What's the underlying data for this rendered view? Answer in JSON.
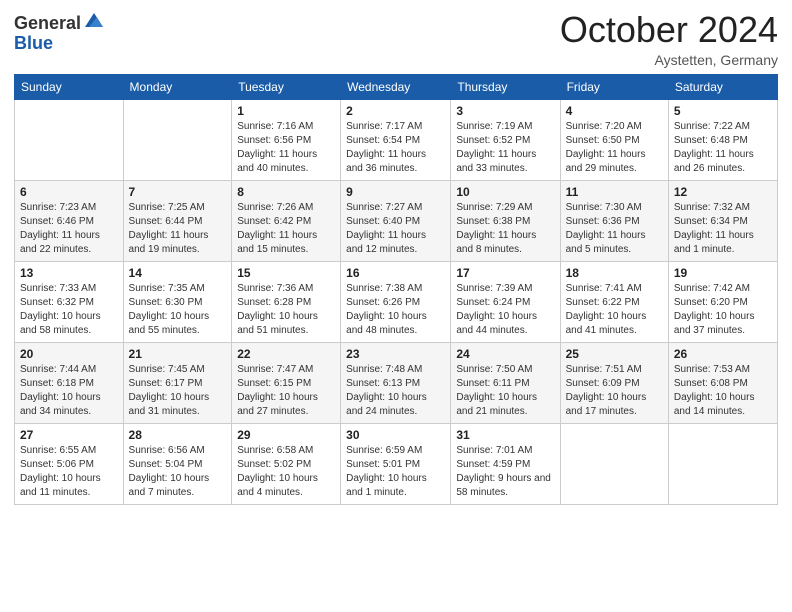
{
  "header": {
    "logo_general": "General",
    "logo_blue": "Blue",
    "month": "October 2024",
    "location": "Aystetten, Germany"
  },
  "weekdays": [
    "Sunday",
    "Monday",
    "Tuesday",
    "Wednesday",
    "Thursday",
    "Friday",
    "Saturday"
  ],
  "weeks": [
    [
      {
        "day": "",
        "info": ""
      },
      {
        "day": "",
        "info": ""
      },
      {
        "day": "1",
        "info": "Sunrise: 7:16 AM\nSunset: 6:56 PM\nDaylight: 11 hours and 40 minutes."
      },
      {
        "day": "2",
        "info": "Sunrise: 7:17 AM\nSunset: 6:54 PM\nDaylight: 11 hours and 36 minutes."
      },
      {
        "day": "3",
        "info": "Sunrise: 7:19 AM\nSunset: 6:52 PM\nDaylight: 11 hours and 33 minutes."
      },
      {
        "day": "4",
        "info": "Sunrise: 7:20 AM\nSunset: 6:50 PM\nDaylight: 11 hours and 29 minutes."
      },
      {
        "day": "5",
        "info": "Sunrise: 7:22 AM\nSunset: 6:48 PM\nDaylight: 11 hours and 26 minutes."
      }
    ],
    [
      {
        "day": "6",
        "info": "Sunrise: 7:23 AM\nSunset: 6:46 PM\nDaylight: 11 hours and 22 minutes."
      },
      {
        "day": "7",
        "info": "Sunrise: 7:25 AM\nSunset: 6:44 PM\nDaylight: 11 hours and 19 minutes."
      },
      {
        "day": "8",
        "info": "Sunrise: 7:26 AM\nSunset: 6:42 PM\nDaylight: 11 hours and 15 minutes."
      },
      {
        "day": "9",
        "info": "Sunrise: 7:27 AM\nSunset: 6:40 PM\nDaylight: 11 hours and 12 minutes."
      },
      {
        "day": "10",
        "info": "Sunrise: 7:29 AM\nSunset: 6:38 PM\nDaylight: 11 hours and 8 minutes."
      },
      {
        "day": "11",
        "info": "Sunrise: 7:30 AM\nSunset: 6:36 PM\nDaylight: 11 hours and 5 minutes."
      },
      {
        "day": "12",
        "info": "Sunrise: 7:32 AM\nSunset: 6:34 PM\nDaylight: 11 hours and 1 minute."
      }
    ],
    [
      {
        "day": "13",
        "info": "Sunrise: 7:33 AM\nSunset: 6:32 PM\nDaylight: 10 hours and 58 minutes."
      },
      {
        "day": "14",
        "info": "Sunrise: 7:35 AM\nSunset: 6:30 PM\nDaylight: 10 hours and 55 minutes."
      },
      {
        "day": "15",
        "info": "Sunrise: 7:36 AM\nSunset: 6:28 PM\nDaylight: 10 hours and 51 minutes."
      },
      {
        "day": "16",
        "info": "Sunrise: 7:38 AM\nSunset: 6:26 PM\nDaylight: 10 hours and 48 minutes."
      },
      {
        "day": "17",
        "info": "Sunrise: 7:39 AM\nSunset: 6:24 PM\nDaylight: 10 hours and 44 minutes."
      },
      {
        "day": "18",
        "info": "Sunrise: 7:41 AM\nSunset: 6:22 PM\nDaylight: 10 hours and 41 minutes."
      },
      {
        "day": "19",
        "info": "Sunrise: 7:42 AM\nSunset: 6:20 PM\nDaylight: 10 hours and 37 minutes."
      }
    ],
    [
      {
        "day": "20",
        "info": "Sunrise: 7:44 AM\nSunset: 6:18 PM\nDaylight: 10 hours and 34 minutes."
      },
      {
        "day": "21",
        "info": "Sunrise: 7:45 AM\nSunset: 6:17 PM\nDaylight: 10 hours and 31 minutes."
      },
      {
        "day": "22",
        "info": "Sunrise: 7:47 AM\nSunset: 6:15 PM\nDaylight: 10 hours and 27 minutes."
      },
      {
        "day": "23",
        "info": "Sunrise: 7:48 AM\nSunset: 6:13 PM\nDaylight: 10 hours and 24 minutes."
      },
      {
        "day": "24",
        "info": "Sunrise: 7:50 AM\nSunset: 6:11 PM\nDaylight: 10 hours and 21 minutes."
      },
      {
        "day": "25",
        "info": "Sunrise: 7:51 AM\nSunset: 6:09 PM\nDaylight: 10 hours and 17 minutes."
      },
      {
        "day": "26",
        "info": "Sunrise: 7:53 AM\nSunset: 6:08 PM\nDaylight: 10 hours and 14 minutes."
      }
    ],
    [
      {
        "day": "27",
        "info": "Sunrise: 6:55 AM\nSunset: 5:06 PM\nDaylight: 10 hours and 11 minutes."
      },
      {
        "day": "28",
        "info": "Sunrise: 6:56 AM\nSunset: 5:04 PM\nDaylight: 10 hours and 7 minutes."
      },
      {
        "day": "29",
        "info": "Sunrise: 6:58 AM\nSunset: 5:02 PM\nDaylight: 10 hours and 4 minutes."
      },
      {
        "day": "30",
        "info": "Sunrise: 6:59 AM\nSunset: 5:01 PM\nDaylight: 10 hours and 1 minute."
      },
      {
        "day": "31",
        "info": "Sunrise: 7:01 AM\nSunset: 4:59 PM\nDaylight: 9 hours and 58 minutes."
      },
      {
        "day": "",
        "info": ""
      },
      {
        "day": "",
        "info": ""
      }
    ]
  ]
}
